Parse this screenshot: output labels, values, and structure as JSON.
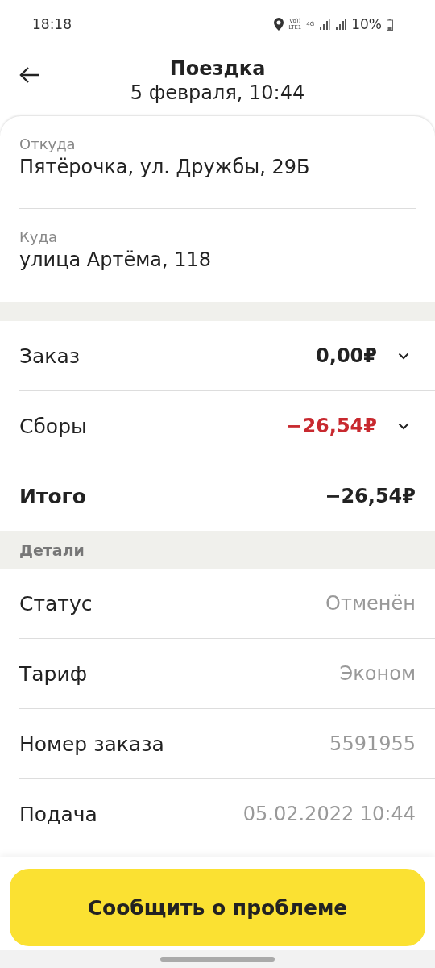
{
  "status_bar": {
    "time": "18:18",
    "volte": "Vo))",
    "lte": "LTE1",
    "network": "4G",
    "battery": "10%"
  },
  "header": {
    "title": "Поездка",
    "subtitle": "5 февраля, 10:44"
  },
  "route": [
    {
      "label": "Откуда",
      "value": "Пятёрочка, ул. Дружбы, 29Б"
    },
    {
      "label": "Куда",
      "value": "улица Артёма, 118"
    }
  ],
  "amounts": [
    {
      "kind": "line",
      "label": "Заказ",
      "value": "0,00₽",
      "negative": false,
      "expandable": true
    },
    {
      "kind": "line",
      "label": "Сборы",
      "value": "−26,54₽",
      "negative": true,
      "expandable": true
    },
    {
      "kind": "total",
      "label": "Итого",
      "value": "−26,54₽",
      "negative": false,
      "expandable": false
    }
  ],
  "details": {
    "title": "Детали",
    "rows": [
      {
        "label": "Статус",
        "value": "Отменён"
      },
      {
        "label": "Тариф",
        "value": "Эконом"
      },
      {
        "label": "Номер заказа",
        "value": "5591955"
      },
      {
        "label": "Подача",
        "value": "05.02.2022 10:44"
      }
    ]
  },
  "button": {
    "label": "Сообщить о проблеме"
  }
}
